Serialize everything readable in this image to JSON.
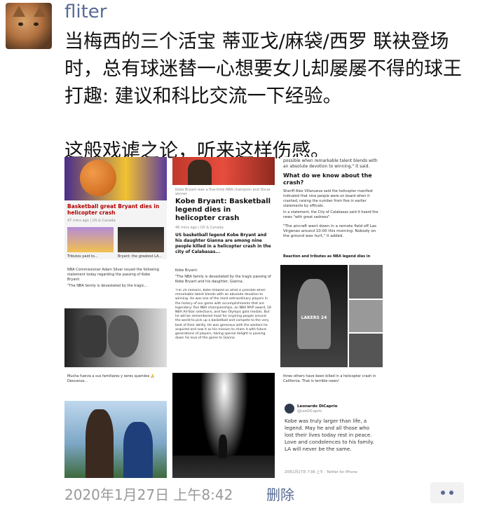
{
  "post": {
    "username": "fliter",
    "text": "当梅西的三个活宝 蒂亚戈/麻袋/西罗 联袂登场时，总有球迷替一心想要女儿却屡屡不得的球王打趣: 建议和科比交流一下经验。\n\n这般戏谑之论，听来这样伤感。",
    "timestamp": "2020年1月27日 上午8:42",
    "delete_label": "删除"
  },
  "images": {
    "img1": {
      "headline": "Basketball great Bryant dies in helicopter crash",
      "meta": "47 mins ago | US & Canada",
      "sub_left": "Tributes paid to...",
      "sub_right": "Bryant: the greatest LA..."
    },
    "img2": {
      "caption": "Kobe Bryant was a five-time NBA champion and Oscar winner",
      "headline": "Kobe Bryant: Basketball legend dies in helicopter crash",
      "meta": "46 mins ago | US & Canada",
      "body": "US basketball legend Kobe Bryant and his daughter Gianna are among nine people killed in a helicopter crash in the city of Calabasas..."
    },
    "img3": {
      "body1": "possible when remarkable talent blends with an absolute devotion to winning,\" it said.",
      "heading": "What do we know about the crash?",
      "body2": "Sheriff Alex Villanueva said the helicopter manifest indicated that nine people were on board when it crashed, raising the number from five in earlier statements by officials.",
      "body3": "In a statement, the City of Calabasas said it heard the news \"with great sadness\".",
      "body4": "\"The aircraft went down in a remote field off Las Virgenes around 10:00 this morning. Nobody on the ground was hurt,\" it added.",
      "bullet": "Reaction and tributes as NBA legend dies in"
    },
    "img4": {
      "body": "NBA Commissioner Adam Silver issued the following statement today regarding the passing of Kobe Bryant:",
      "quote": "\"The NBA family is devastated by the tragic..."
    },
    "img5": {
      "author": "Kobe Bryant:",
      "para1": "\"The NBA family is devastated by the tragic passing of Kobe Bryant and his daughter, Gianna.",
      "para2": "\"For 20 seasons, Kobe showed us what is possible when remarkable talent blends with an absolute devotion to winning. He was one of the most extraordinary players in the history of our game with accomplishments that are legendary: five NBA championships, an NBA MVP award, 18 NBA All-Star selections, and two Olympic gold medals. But he will be remembered most for inspiring people around the world to pick up a basketball and compete to the very best of their ability. He was generous with the wisdom he acquired and saw it as his mission to share it with future generations of players, taking special delight in passing down his love of the game to Gianna."
    },
    "img6": {
      "jersey": "LAKERS 24"
    },
    "img7": {
      "caption": "Mucha fuerza a sus familiares y seres queridos 🙏 Descansa..."
    },
    "img8": {},
    "img9": {
      "top": "three others have been killed in a helicopter crash in California. That is terrible news!",
      "name": "Leonardo DiCaprio",
      "handle": "@LeoDiCaprio",
      "tweet": "Kobe was truly larger than life, a legend. May he and all those who lost their lives today rest in peace. Love and condolences to his family. LA will never be the same.",
      "meta": "20年1月27日 7:06 上午 · Twitter for iPhone"
    }
  }
}
